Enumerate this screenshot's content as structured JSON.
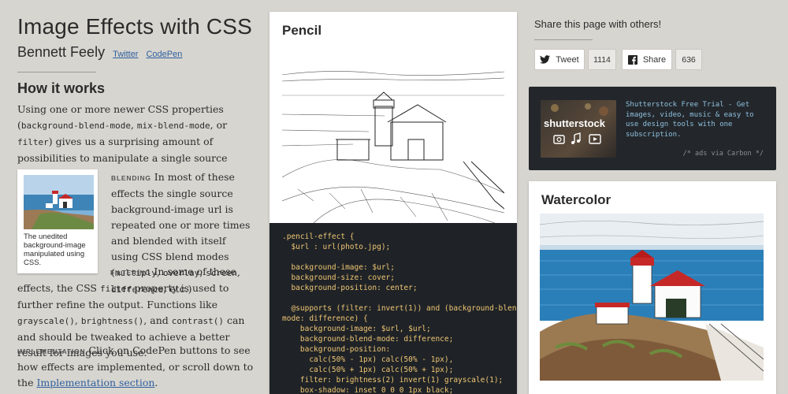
{
  "site": {
    "title": "Image Effects with CSS",
    "author": "Bennett Feely",
    "links": [
      "Twitter",
      "CodePen"
    ]
  },
  "how_it_works": {
    "heading": "How it works",
    "intro_1": "Using one or more newer CSS properties (",
    "intro_code_1": "background-blend-mode",
    "intro_sep_1": ", ",
    "intro_code_2": "mix-blend-mode",
    "intro_sep_2": ", or ",
    "intro_code_3": "filter",
    "intro_2": ") gives us a surprising amount of possibilities to manipulate a single source image.",
    "thumb_caption": "The unedited background-image manipulated using CSS.",
    "blending_label": "Blending",
    "blending_text_1": " In most of these effects the single source background-image url is repeated one or more times and blended with itself using CSS blend modes (",
    "blend_modes": [
      "multiply",
      "overlay",
      "screen",
      "difference"
    ],
    "blending_text_2": ", etc.)",
    "filtering_label": "Filtering",
    "filtering_text_1": " In some of these effects, the CSS ",
    "filtering_code": "filter",
    "filtering_text_2": " property is used to further refine the output. Functions like ",
    "filter_funcs": [
      "grayscale()",
      "brightness()",
      "contrast()"
    ],
    "filtering_text_3": " can and should be tweaked to achieve a better result for images you use.",
    "impl_label": "Implementation",
    "impl_text_1": " Click on CodePen buttons to see how effects are implemented, or scroll down to the ",
    "impl_link": "Implementation section",
    "impl_text_2": "."
  },
  "pencil_card": {
    "title": "Pencil",
    "code": [
      ".pencil-effect {",
      "  $url : url(photo.jpg);",
      "",
      "  background-image: $url;",
      "  background-size: cover;",
      "  background-position: center;",
      "",
      "  @supports (filter: invert(1)) and (background-blend-",
      "mode: difference) {",
      "    background-image: $url, $url;",
      "    background-blend-mode: difference;",
      "    background-position:",
      "      calc(50% - 1px) calc(50% - 1px),",
      "      calc(50% + 1px) calc(50% + 1px);",
      "    filter: brightness(2) invert(1) grayscale(1);",
      "    box-shadow: inset 0 0 0 1px black;"
    ]
  },
  "share": {
    "title": "Share this page with others!",
    "tweet_label": "Tweet",
    "tweet_count": "1114",
    "share_label": "Share",
    "share_count": "636"
  },
  "ad": {
    "logo": "shutterstock",
    "text": "Shutterstock Free Trial - Get images, video, music & easy to use design tools with one subscription.",
    "via": "/* ads via Carbon */"
  },
  "watercolor_card": {
    "title": "Watercolor"
  },
  "colors": {
    "background": "#d7d5cf",
    "link": "#2f5f9f",
    "code_bg": "#1f2327",
    "code_text": "#f0c674",
    "ad_bg": "#23272b",
    "ad_text": "#8fc0df"
  }
}
